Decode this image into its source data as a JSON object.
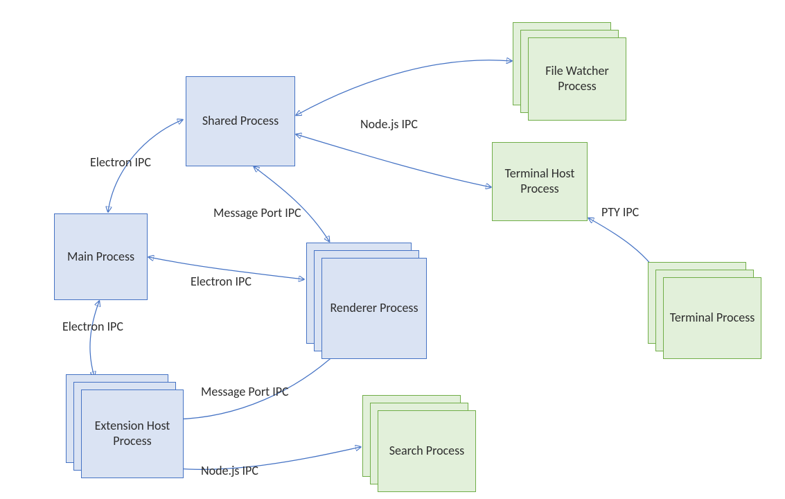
{
  "nodes": {
    "shared_process": "Shared Process",
    "main_process": "Main Process",
    "renderer_process": "Renderer Process",
    "extension_host_process": "Extension Host Process",
    "file_watcher_process": "File Watcher Process",
    "terminal_host_process": "Terminal Host Process",
    "terminal_process": "Terminal Process",
    "search_process": "Search Process"
  },
  "edges": {
    "electron_ipc_main_shared": "Electron IPC",
    "electron_ipc_main_renderer": "Electron IPC",
    "electron_ipc_main_exthost": "Electron IPC",
    "message_port_ipc_shared_renderer": "Message Port IPC",
    "message_port_ipc_renderer_exthost": "Message Port IPC",
    "nodejs_ipc_shared_filewatcher": "Node.js IPC",
    "nodejs_ipc_exthost_search": "Node.js IPC",
    "pty_ipc": "PTY IPC"
  }
}
